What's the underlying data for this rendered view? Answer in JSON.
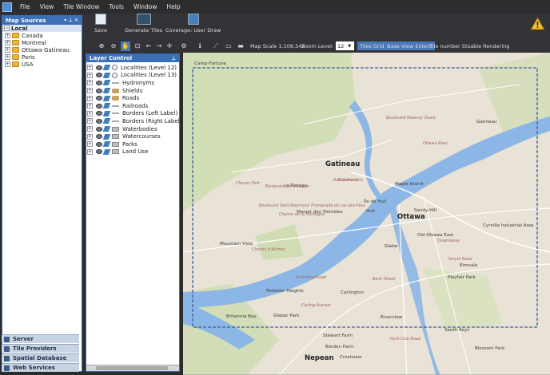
{
  "menu": [
    "File",
    "View",
    "Tile Window",
    "Tools",
    "Window",
    "Help"
  ],
  "toolbar": {
    "save": "Save",
    "generate_tiles": "Generate Tiles",
    "coverage": "Coverage: User Draw",
    "map_scale": "Map Scale 1:108,548",
    "zoom_level_label": "Zoom Level:",
    "zoom_level": "12",
    "tiles_grid": "Tiles Grid",
    "base_view_extent": "Base View Extent",
    "tile_number": "Tile number",
    "disable_rendering": "Disable Rendering"
  },
  "map_sources": {
    "title": "Map Sources",
    "local": "Local",
    "items": [
      "Canada",
      "Montreal",
      "Ottawa-Gatineau",
      "Paris",
      "USA"
    ]
  },
  "bottom_tabs": [
    "Server",
    "Tile Providers",
    "Spatial Database",
    "Web Services"
  ],
  "layer_control": {
    "title": "Layer Control",
    "layers": [
      {
        "name": "Localities (Level 12)",
        "type": "circle"
      },
      {
        "name": "Localities (Level 13)",
        "type": "circle"
      },
      {
        "name": "Hydronyms",
        "type": "line"
      },
      {
        "name": "Shields",
        "type": "shield"
      },
      {
        "name": "Roads",
        "type": "shield"
      },
      {
        "name": "Railroads",
        "type": "line"
      },
      {
        "name": "Borders (Left Label)",
        "type": "line"
      },
      {
        "name": "Borders (Right Label)",
        "type": "line"
      },
      {
        "name": "Waterbodies",
        "type": "polygon"
      },
      {
        "name": "Watercourses",
        "type": "polygon"
      },
      {
        "name": "Parks",
        "type": "polygon"
      },
      {
        "name": "Land Use",
        "type": "polygon"
      }
    ]
  },
  "map_labels": [
    {
      "text": "Gatineau",
      "cls": "big"
    },
    {
      "text": "Ottawa",
      "cls": "big"
    },
    {
      "text": "Camp-Fortune",
      "cls": ""
    },
    {
      "text": "Le Plateau",
      "cls": ""
    },
    {
      "text": "Île de Hull",
      "cls": ""
    },
    {
      "text": "Hull",
      "cls": ""
    },
    {
      "text": "Manoir des Trembles",
      "cls": ""
    },
    {
      "text": "Maple Island",
      "cls": ""
    },
    {
      "text": "Sandy Hill",
      "cls": ""
    },
    {
      "text": "Old Ottawa East",
      "cls": ""
    },
    {
      "text": "Cyrville Industrial Area",
      "cls": ""
    },
    {
      "text": "Mountain View",
      "cls": ""
    },
    {
      "text": "Glebe",
      "cls": ""
    },
    {
      "text": "Elmvale",
      "cls": ""
    },
    {
      "text": "Playfair Park",
      "cls": ""
    },
    {
      "text": "McKellar Heights",
      "cls": ""
    },
    {
      "text": "Carlington",
      "cls": ""
    },
    {
      "text": "Britannia Bay",
      "cls": ""
    },
    {
      "text": "Glabar Park",
      "cls": ""
    },
    {
      "text": "Riverview",
      "cls": ""
    },
    {
      "text": "South Keys",
      "cls": ""
    },
    {
      "text": "Stewart Farm",
      "cls": ""
    },
    {
      "text": "Borden Farm",
      "cls": ""
    },
    {
      "text": "Nepean",
      "cls": "big"
    },
    {
      "text": "Crestview",
      "cls": ""
    },
    {
      "text": "Blossom Park",
      "cls": ""
    },
    {
      "text": "Gatineau",
      "cls": ""
    },
    {
      "text": "Ottawa River",
      "cls": "road"
    },
    {
      "text": "Boulevard Maloney Ouest",
      "cls": "road"
    },
    {
      "text": "Boulevard de la Gappe",
      "cls": "road"
    },
    {
      "text": "Chemin de la Montagne",
      "cls": "road"
    },
    {
      "text": "Promenade du Lac-des-Fées",
      "cls": "road"
    },
    {
      "text": "Chemin Pink",
      "cls": "road"
    },
    {
      "text": "Rue Gamelin",
      "cls": "road"
    },
    {
      "text": "Boulevard Saint-Raymond",
      "cls": "road"
    },
    {
      "text": "Rue Gamelin",
      "cls": "road"
    },
    {
      "text": "Chemin d'Aylmer",
      "cls": "road"
    },
    {
      "text": "Richmond Road",
      "cls": "road"
    },
    {
      "text": "Carling Avenue",
      "cls": "road"
    },
    {
      "text": "Queensway",
      "cls": "road"
    },
    {
      "text": "Bank Street",
      "cls": "road"
    },
    {
      "text": "Hunt Club Road",
      "cls": "road"
    },
    {
      "text": "Smyth Road",
      "cls": "road"
    }
  ]
}
